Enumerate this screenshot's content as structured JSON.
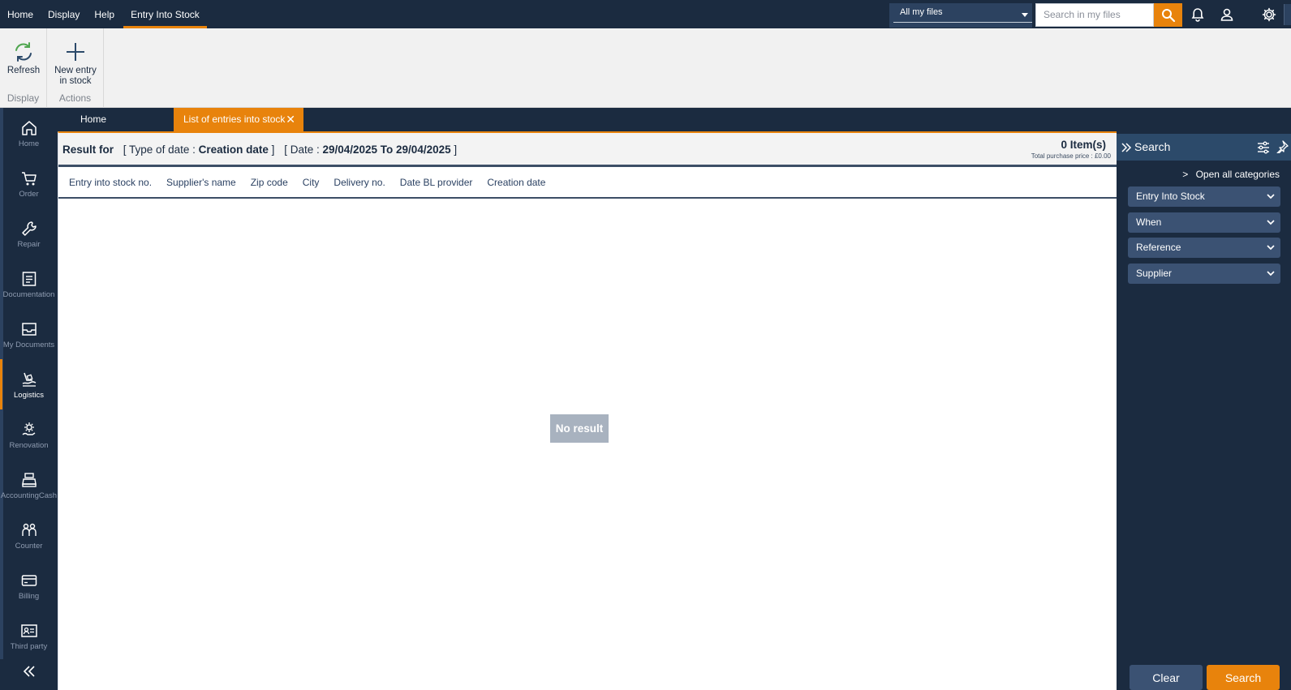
{
  "topmenu": {
    "items": [
      {
        "label": "Home"
      },
      {
        "label": "Display"
      },
      {
        "label": "Help"
      },
      {
        "label": "Entry Into Stock"
      }
    ],
    "active_index": 3
  },
  "file_selector": {
    "value": "All my files"
  },
  "global_search": {
    "placeholder": "Search in my files"
  },
  "ribbon": {
    "groups": [
      {
        "label": "Display",
        "buttons": [
          {
            "label": "Refresh"
          }
        ]
      },
      {
        "label": "Actions",
        "buttons": [
          {
            "label_line1": "New entry",
            "label_line2": "in stock"
          }
        ]
      }
    ]
  },
  "sidebar": {
    "items": [
      {
        "label": "Home",
        "icon": "home-icon"
      },
      {
        "label": "Order",
        "icon": "cart-icon"
      },
      {
        "label": "Repair",
        "icon": "wrench-icon"
      },
      {
        "label": "Documentation",
        "icon": "document-icon"
      },
      {
        "label": "My Documents",
        "icon": "inbox-icon"
      },
      {
        "label": "Logistics",
        "icon": "logistics-icon"
      },
      {
        "label": "Renovation",
        "icon": "renovation-icon"
      },
      {
        "label": "AccountingCash",
        "icon": "cash-register-icon"
      },
      {
        "label": "Counter",
        "icon": "people-icon"
      },
      {
        "label": "Billing",
        "icon": "card-icon"
      },
      {
        "label": "Third party",
        "icon": "id-card-icon"
      }
    ],
    "active_index": 5
  },
  "tabs": {
    "home": "Home",
    "active": "List of entries into stock",
    "close": "✕"
  },
  "result": {
    "prefix": "Result for",
    "date_type_label": "[ Type of date :",
    "date_type_value": "Creation date",
    "date_type_close": "]",
    "date_label": "[ Date :",
    "date_value": "29/04/2025 To 29/04/2025",
    "date_close": "]",
    "item_count": "0 Item(s)",
    "total_price": "Total purchase price : £0.00"
  },
  "table": {
    "columns": [
      "Entry into stock no.",
      "Supplier's name",
      "Zip code",
      "City",
      "Delivery no.",
      "Date BL provider",
      "Creation date"
    ],
    "rows": [],
    "empty_text": "No result"
  },
  "search_panel": {
    "title": "Search",
    "open_all": "Open all categories",
    "categories": [
      "Entry Into Stock",
      "When",
      "Reference",
      "Supplier"
    ],
    "clear_label": "Clear",
    "search_label": "Search"
  },
  "colors": {
    "navy": "#1b2b40",
    "accent_orange": "#e8830c",
    "panel_blue": "#3b5273"
  }
}
